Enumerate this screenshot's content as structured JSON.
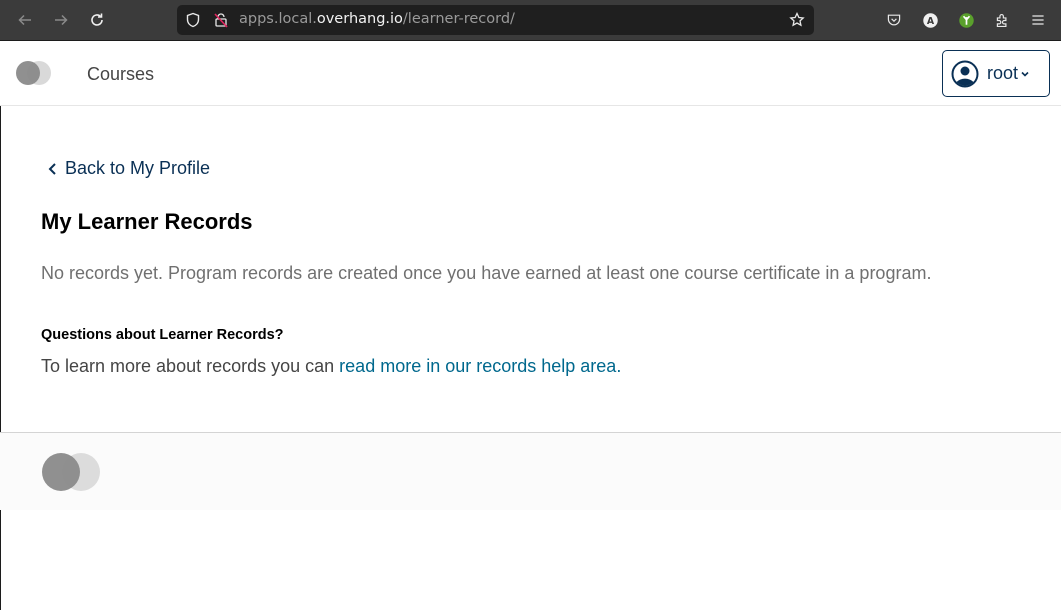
{
  "browser": {
    "url_prefix": "apps.local.",
    "url_domain": "overhang.io",
    "url_path": "/learner-record/",
    "icons": [
      "back-arrow-icon",
      "forward-arrow-icon",
      "reload-icon",
      "shield-icon",
      "insecure-lock-icon",
      "bookmark-star-icon",
      "pocket-icon",
      "account-icon",
      "extension-green-icon",
      "extensions-puzzle-icon",
      "hamburger-menu-icon"
    ],
    "account_badge_letter": "A"
  },
  "header": {
    "courses_label": "Courses",
    "user_name": "root"
  },
  "main": {
    "back_link_label": "Back to My Profile",
    "title": "My Learner Records",
    "empty_message": "No records yet. Program records are created once you have earned at least one course certificate in a program.",
    "help_heading": "Questions about Learner Records?",
    "help_text_prefix": "To learn more about records you can ",
    "help_link_label": "read more in our records help area."
  },
  "colors": {
    "brand_dark": "#0a3055",
    "link": "#00688d",
    "muted_text": "#707070"
  }
}
